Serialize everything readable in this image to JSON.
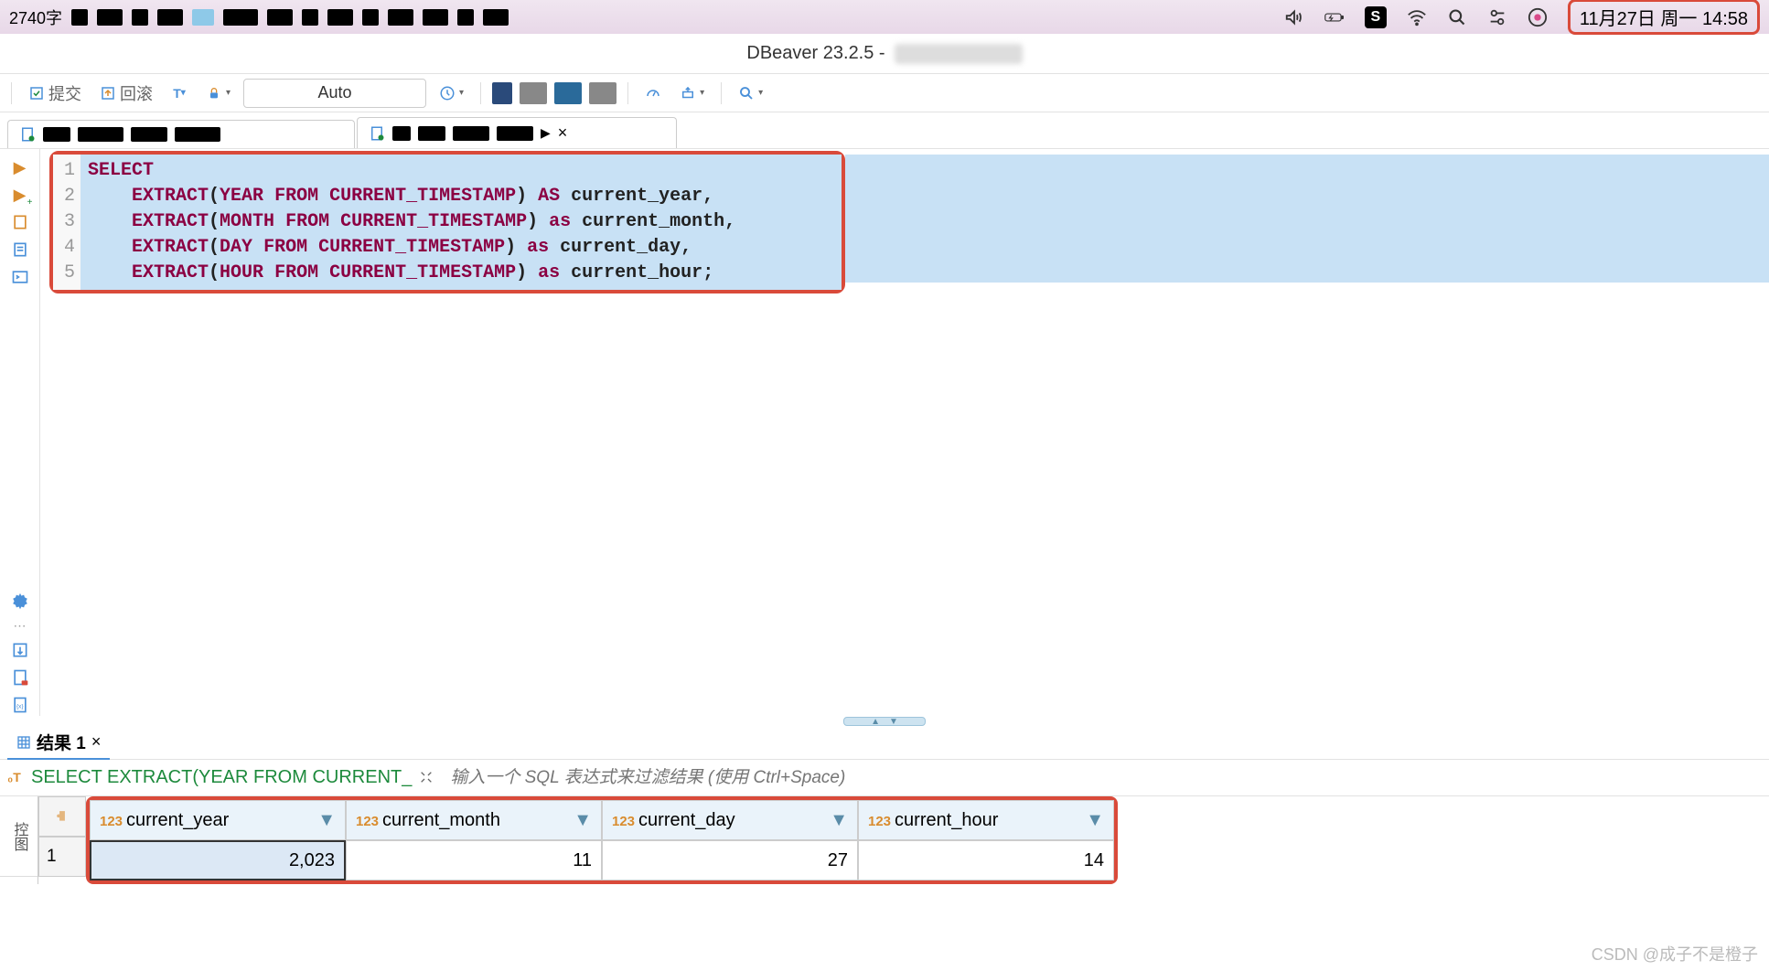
{
  "menubar": {
    "word_count": "2740字",
    "datetime": "11月27日 周一  14:58"
  },
  "titlebar": {
    "title": "DBeaver 23.2.5 - "
  },
  "toolbar": {
    "commit_label": "提交",
    "rollback_label": "回滚",
    "auto_label": "Auto"
  },
  "editor": {
    "lines": [
      "1",
      "2",
      "3",
      "4",
      "5"
    ],
    "code": {
      "l1": "SELECT",
      "l2": {
        "indent": "    ",
        "fn": "EXTRACT",
        "open": "(",
        "kw1": "YEAR",
        "from": " FROM ",
        "cur": "CURRENT_TIMESTAMP",
        "close": ")",
        "as": " AS ",
        "alias": "current_year",
        "end": ","
      },
      "l3": {
        "indent": "    ",
        "fn": "EXTRACT",
        "open": "(",
        "kw1": "MONTH",
        "from": " FROM ",
        "cur": "CURRENT_TIMESTAMP",
        "close": ")",
        "as": " as ",
        "alias": "current_month",
        "end": ","
      },
      "l4": {
        "indent": "    ",
        "fn": "EXTRACT",
        "open": "(",
        "kw1": "DAY",
        "from": " FROM ",
        "cur": "CURRENT_TIMESTAMP",
        "close": ")",
        "as": " as ",
        "alias": "current_day",
        "end": ","
      },
      "l5": {
        "indent": "    ",
        "fn": "EXTRACT",
        "open": "(",
        "kw1": "HOUR",
        "from": " FROM ",
        "cur": "CURRENT_TIMESTAMP",
        "close": ")",
        "as": " as ",
        "alias": "current_hour",
        "end": ";"
      }
    }
  },
  "results": {
    "tab_label": "结果 1",
    "sql_snippet": "SELECT EXTRACT(YEAR FROM CURRENT_",
    "filter_placeholder": "输入一个 SQL 表达式来过滤结果 (使用 Ctrl+Space)",
    "side_label": "控图",
    "col_type_prefix": "123",
    "columns": [
      "current_year",
      "current_month",
      "current_day",
      "current_hour"
    ],
    "row_num": "1",
    "row_data": [
      "2,023",
      "11",
      "27",
      "14"
    ]
  },
  "watermark": "CSDN @成子不是橙子"
}
